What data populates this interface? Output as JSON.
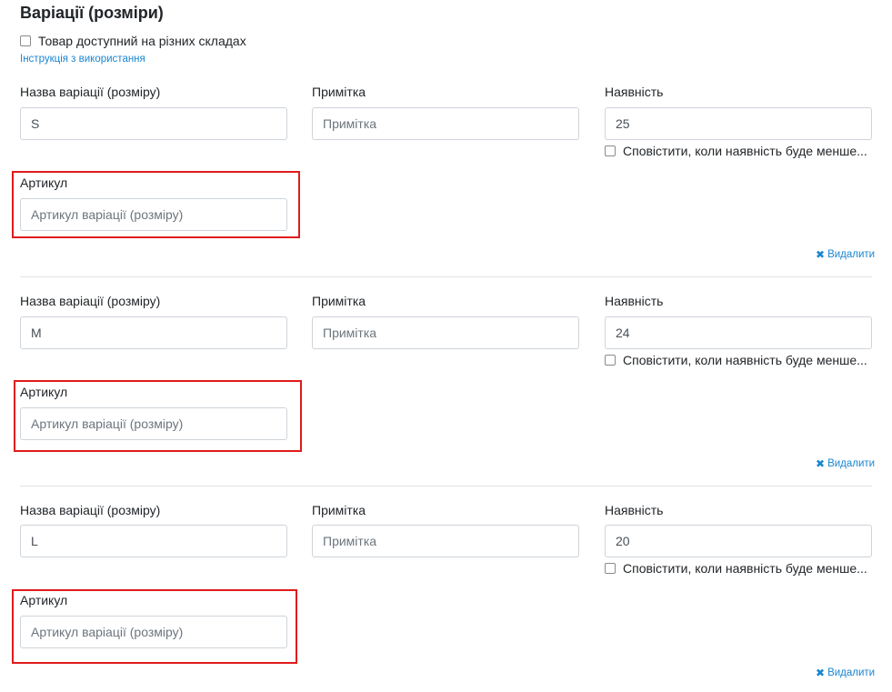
{
  "section": {
    "title": "Варіації (розміри)",
    "multi_warehouse_label": "Товар доступний на різних складах",
    "instructions_link": "Інструкція з використання"
  },
  "labels": {
    "name": "Назва варіації (розміру)",
    "note": "Примітка",
    "stock": "Наявність",
    "sku": "Артикул",
    "notify": "Сповістити, коли наявність буде менше...",
    "delete": "Видалити"
  },
  "placeholders": {
    "note": "Примітка",
    "sku": "Артикул варіації (розміру)"
  },
  "variants": [
    {
      "name": "S",
      "note": "",
      "stock": "25",
      "sku": ""
    },
    {
      "name": "M",
      "note": "",
      "stock": "24",
      "sku": ""
    },
    {
      "name": "L",
      "note": "",
      "stock": "20",
      "sku": ""
    }
  ],
  "colors": {
    "link": "#1a86d0",
    "highlight": "#e01b1b"
  }
}
